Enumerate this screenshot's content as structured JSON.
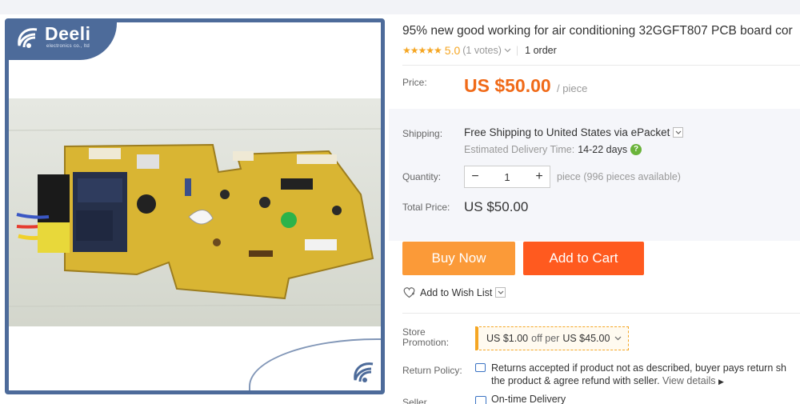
{
  "gallery": {
    "brand_name": "Deeli",
    "brand_sub": "electronics co., ltd",
    "photo_alt": "air conditioning PCB board"
  },
  "product": {
    "title": "95% new good working for air conditioning 32GGFT807 PCB board cor",
    "rating_stars": "★★★★★",
    "rating_score": "5.0",
    "rating_votes": "(1 votes)",
    "orders": "1 order"
  },
  "price": {
    "label": "Price:",
    "value": "US $50.00",
    "unit": "/ piece"
  },
  "shipping": {
    "label": "Shipping:",
    "method": "Free Shipping to United States via ePacket",
    "eta_label": "Estimated Delivery Time:",
    "eta_days": "14-22 days"
  },
  "quantity": {
    "label": "Quantity:",
    "minus": "−",
    "value": "1",
    "plus": "+",
    "available": "piece (996 pieces available)"
  },
  "total": {
    "label": "Total Price:",
    "value": "US $50.00"
  },
  "actions": {
    "buy_now": "Buy Now",
    "add_to_cart": "Add to Cart",
    "wish_list": "Add to Wish List"
  },
  "promotion": {
    "label_line1": "Store",
    "label_line2": "Promotion:",
    "amount": "US $1.00",
    "off_per": "off per",
    "threshold": "US $45.00"
  },
  "return_policy": {
    "label": "Return Policy:",
    "line1": "Returns accepted if product not as described, buyer pays return sh",
    "line2": "the product & agree refund with seller.",
    "view_details": "View details"
  },
  "seller": {
    "label": "Seller",
    "guarantee": "On-time Delivery"
  },
  "colors": {
    "accent_price": "#f06a18",
    "buy_now": "#fb9a38",
    "add_to_cart": "#ff5a1f",
    "frame": "#4d6b9a",
    "star": "#f5a623"
  }
}
